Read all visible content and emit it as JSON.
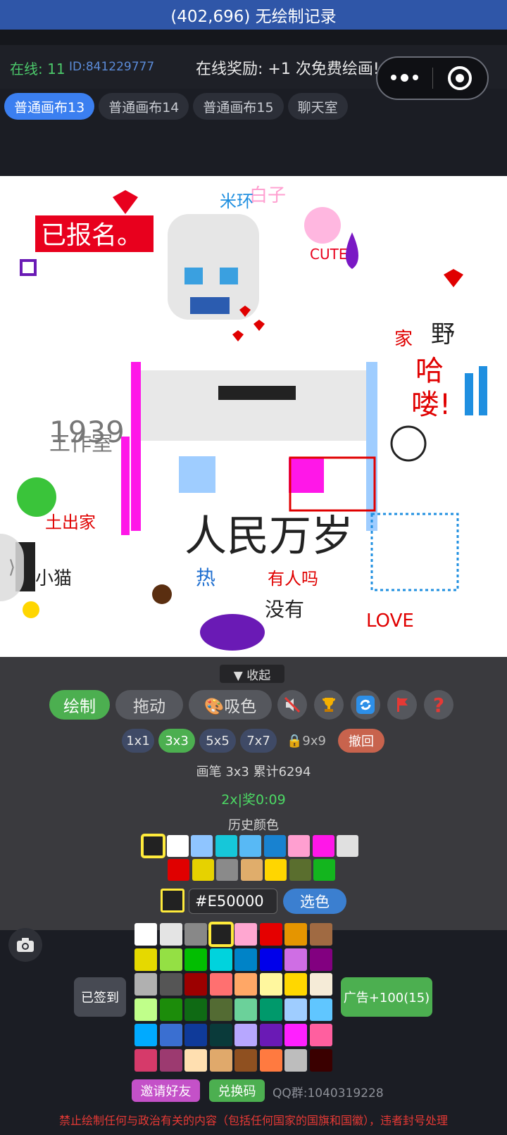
{
  "header": {
    "title": "(402,696) 无绘制记录"
  },
  "info": {
    "online_label": "在线: 11",
    "user_id": "ID:841229777",
    "reward_text": "在线奖励: +1 次免费绘画!"
  },
  "tabs": [
    {
      "label": "普通画布13",
      "active": true
    },
    {
      "label": "普通画布14",
      "active": false
    },
    {
      "label": "普通画布15",
      "active": false
    },
    {
      "label": "聊天室",
      "active": false
    }
  ],
  "canvas": {
    "texts": [
      "已报名。",
      "CUTE",
      "1939",
      "工作室",
      "哈",
      "喽!",
      "热",
      "有人吗",
      "没有",
      "LOVE",
      "小猫",
      "土出家",
      "人民万岁",
      "野",
      "家",
      "白子",
      "米环"
    ]
  },
  "controls": {
    "collapse_label": "▼ 收起",
    "draw_label": "绘制",
    "drag_label": "拖动",
    "pick_label": "🎨吸色",
    "icons": [
      "mute-icon",
      "trophy-icon",
      "refresh-icon",
      "flag-icon",
      "help-icon"
    ],
    "sizes": [
      "1x1",
      "3x3",
      "5x5",
      "7x7"
    ],
    "active_size": "3x3",
    "locked_size": "🔒9x9",
    "undo_label": "撤回",
    "pen_info": "画笔 3x3  累计6294",
    "bonus_text": "2x|奖0:09",
    "history_label": "历史颜色"
  },
  "history_colors": [
    "#222222",
    "#ffffff",
    "#8fc5ff",
    "#16c7d9",
    "#58b9f5",
    "#1882d0",
    "#ff9fd0",
    "#ff17e8",
    "#e0e0e0",
    "#e00000",
    "#e6d200",
    "#8a8a8a",
    "#e0ad6b",
    "#ffd600",
    "#5a6e2e",
    "#13b51e"
  ],
  "color_input": {
    "current": "#222222",
    "value": "#E50000",
    "button_label": "选色"
  },
  "palette": [
    "#ffffff",
    "#e4e4e4",
    "#888888",
    "#222222",
    "#ffa7d1",
    "#e50000",
    "#e59500",
    "#a06a42",
    "#e5d900",
    "#94e044",
    "#02be01",
    "#00d3dd",
    "#0083c7",
    "#0000ea",
    "#cf6ee4",
    "#820080",
    "#b0b0b0",
    "#555555",
    "#9c0000",
    "#ff7070",
    "#ffa766",
    "#fff79e",
    "#ffd700",
    "#f5ebd7",
    "#c0ff8a",
    "#1c8c0a",
    "#0f6a14",
    "#536b33",
    "#6bd19a",
    "#00996b",
    "#9fcdff",
    "#60c6ff",
    "#00aaff",
    "#3a6fd1",
    "#0f3a99",
    "#0a3a3a",
    "#b7a7ff",
    "#6a1ab5",
    "#ff20ff",
    "#ff5f9f",
    "#d63a6a",
    "#9c3a70",
    "#ffdfb0",
    "#e0a96b",
    "#8f5020",
    "#ff7a40",
    "#bdbdbd",
    "#3a0000"
  ],
  "palette_selected": "#222222",
  "bottom": {
    "signed_label": "已签到",
    "ad_label": "广告+100(15)",
    "invite_label": "邀请好友",
    "redeem_label": "兑换码",
    "qq_group": "QQ群:1040319228",
    "warning": "禁止绘制任何与政治有关的内容（包括任何国家的国旗和国徽），违者封号处理"
  }
}
